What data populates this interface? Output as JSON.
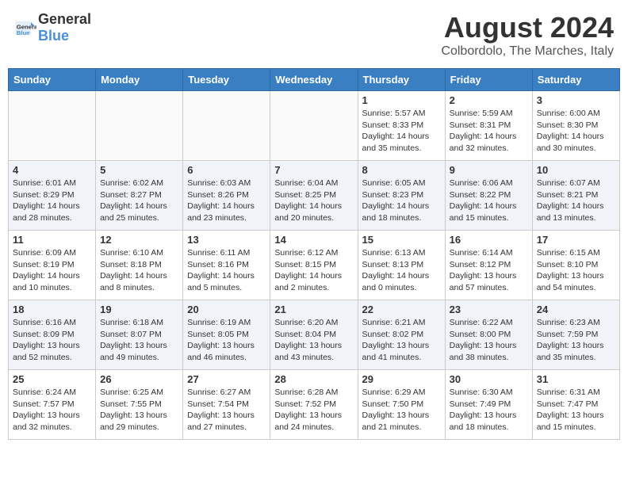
{
  "header": {
    "logo_general": "General",
    "logo_blue": "Blue",
    "month_title": "August 2024",
    "location": "Colbordolo, The Marches, Italy"
  },
  "days_of_week": [
    "Sunday",
    "Monday",
    "Tuesday",
    "Wednesday",
    "Thursday",
    "Friday",
    "Saturday"
  ],
  "weeks": [
    [
      {
        "day": "",
        "info": ""
      },
      {
        "day": "",
        "info": ""
      },
      {
        "day": "",
        "info": ""
      },
      {
        "day": "",
        "info": ""
      },
      {
        "day": "1",
        "info": "Sunrise: 5:57 AM\nSunset: 8:33 PM\nDaylight: 14 hours and 35 minutes."
      },
      {
        "day": "2",
        "info": "Sunrise: 5:59 AM\nSunset: 8:31 PM\nDaylight: 14 hours and 32 minutes."
      },
      {
        "day": "3",
        "info": "Sunrise: 6:00 AM\nSunset: 8:30 PM\nDaylight: 14 hours and 30 minutes."
      }
    ],
    [
      {
        "day": "4",
        "info": "Sunrise: 6:01 AM\nSunset: 8:29 PM\nDaylight: 14 hours and 28 minutes."
      },
      {
        "day": "5",
        "info": "Sunrise: 6:02 AM\nSunset: 8:27 PM\nDaylight: 14 hours and 25 minutes."
      },
      {
        "day": "6",
        "info": "Sunrise: 6:03 AM\nSunset: 8:26 PM\nDaylight: 14 hours and 23 minutes."
      },
      {
        "day": "7",
        "info": "Sunrise: 6:04 AM\nSunset: 8:25 PM\nDaylight: 14 hours and 20 minutes."
      },
      {
        "day": "8",
        "info": "Sunrise: 6:05 AM\nSunset: 8:23 PM\nDaylight: 14 hours and 18 minutes."
      },
      {
        "day": "9",
        "info": "Sunrise: 6:06 AM\nSunset: 8:22 PM\nDaylight: 14 hours and 15 minutes."
      },
      {
        "day": "10",
        "info": "Sunrise: 6:07 AM\nSunset: 8:21 PM\nDaylight: 14 hours and 13 minutes."
      }
    ],
    [
      {
        "day": "11",
        "info": "Sunrise: 6:09 AM\nSunset: 8:19 PM\nDaylight: 14 hours and 10 minutes."
      },
      {
        "day": "12",
        "info": "Sunrise: 6:10 AM\nSunset: 8:18 PM\nDaylight: 14 hours and 8 minutes."
      },
      {
        "day": "13",
        "info": "Sunrise: 6:11 AM\nSunset: 8:16 PM\nDaylight: 14 hours and 5 minutes."
      },
      {
        "day": "14",
        "info": "Sunrise: 6:12 AM\nSunset: 8:15 PM\nDaylight: 14 hours and 2 minutes."
      },
      {
        "day": "15",
        "info": "Sunrise: 6:13 AM\nSunset: 8:13 PM\nDaylight: 14 hours and 0 minutes."
      },
      {
        "day": "16",
        "info": "Sunrise: 6:14 AM\nSunset: 8:12 PM\nDaylight: 13 hours and 57 minutes."
      },
      {
        "day": "17",
        "info": "Sunrise: 6:15 AM\nSunset: 8:10 PM\nDaylight: 13 hours and 54 minutes."
      }
    ],
    [
      {
        "day": "18",
        "info": "Sunrise: 6:16 AM\nSunset: 8:09 PM\nDaylight: 13 hours and 52 minutes."
      },
      {
        "day": "19",
        "info": "Sunrise: 6:18 AM\nSunset: 8:07 PM\nDaylight: 13 hours and 49 minutes."
      },
      {
        "day": "20",
        "info": "Sunrise: 6:19 AM\nSunset: 8:05 PM\nDaylight: 13 hours and 46 minutes."
      },
      {
        "day": "21",
        "info": "Sunrise: 6:20 AM\nSunset: 8:04 PM\nDaylight: 13 hours and 43 minutes."
      },
      {
        "day": "22",
        "info": "Sunrise: 6:21 AM\nSunset: 8:02 PM\nDaylight: 13 hours and 41 minutes."
      },
      {
        "day": "23",
        "info": "Sunrise: 6:22 AM\nSunset: 8:00 PM\nDaylight: 13 hours and 38 minutes."
      },
      {
        "day": "24",
        "info": "Sunrise: 6:23 AM\nSunset: 7:59 PM\nDaylight: 13 hours and 35 minutes."
      }
    ],
    [
      {
        "day": "25",
        "info": "Sunrise: 6:24 AM\nSunset: 7:57 PM\nDaylight: 13 hours and 32 minutes."
      },
      {
        "day": "26",
        "info": "Sunrise: 6:25 AM\nSunset: 7:55 PM\nDaylight: 13 hours and 29 minutes."
      },
      {
        "day": "27",
        "info": "Sunrise: 6:27 AM\nSunset: 7:54 PM\nDaylight: 13 hours and 27 minutes."
      },
      {
        "day": "28",
        "info": "Sunrise: 6:28 AM\nSunset: 7:52 PM\nDaylight: 13 hours and 24 minutes."
      },
      {
        "day": "29",
        "info": "Sunrise: 6:29 AM\nSunset: 7:50 PM\nDaylight: 13 hours and 21 minutes."
      },
      {
        "day": "30",
        "info": "Sunrise: 6:30 AM\nSunset: 7:49 PM\nDaylight: 13 hours and 18 minutes."
      },
      {
        "day": "31",
        "info": "Sunrise: 6:31 AM\nSunset: 7:47 PM\nDaylight: 13 hours and 15 minutes."
      }
    ]
  ]
}
